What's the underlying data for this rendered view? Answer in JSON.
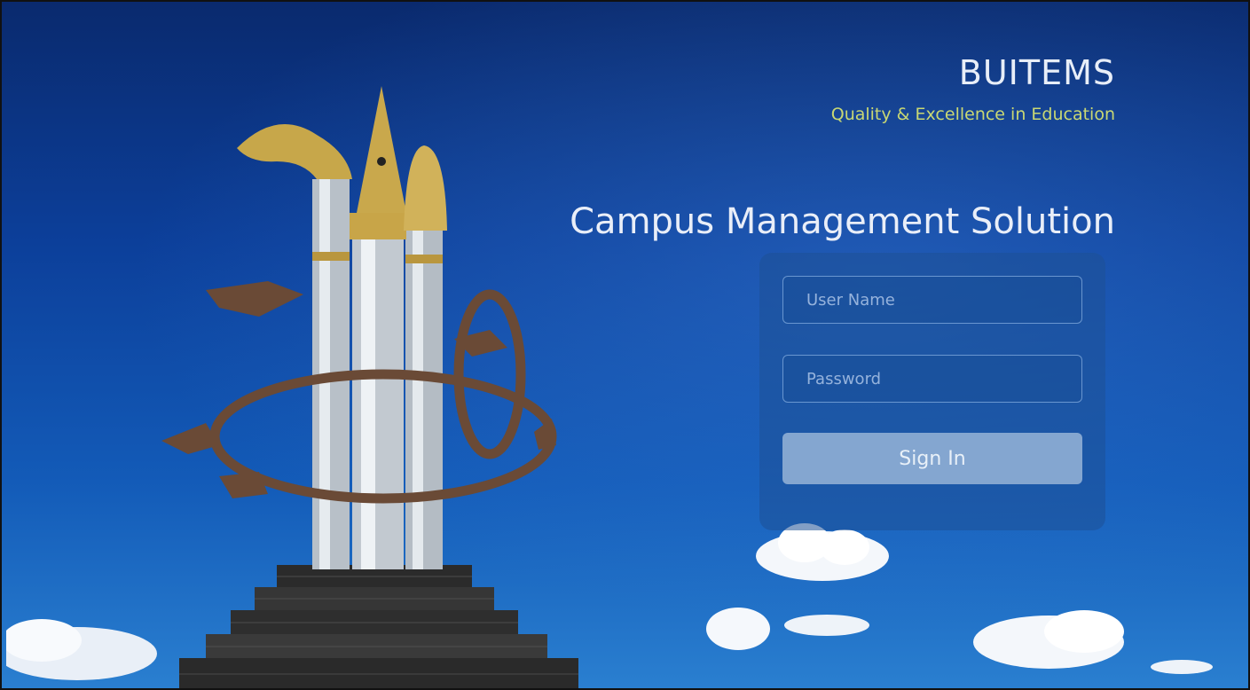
{
  "brand": {
    "title": "BUITEMS",
    "tagline": "Quality & Excellence in Education"
  },
  "app": {
    "title": "Campus Management Solution"
  },
  "login": {
    "username_placeholder": "User Name",
    "password_placeholder": "Password",
    "signin_label": "Sign In"
  },
  "colors": {
    "tagline": "#c9d873",
    "sky_top": "#0a2a6e",
    "sky_bottom": "#2a7fd0"
  }
}
